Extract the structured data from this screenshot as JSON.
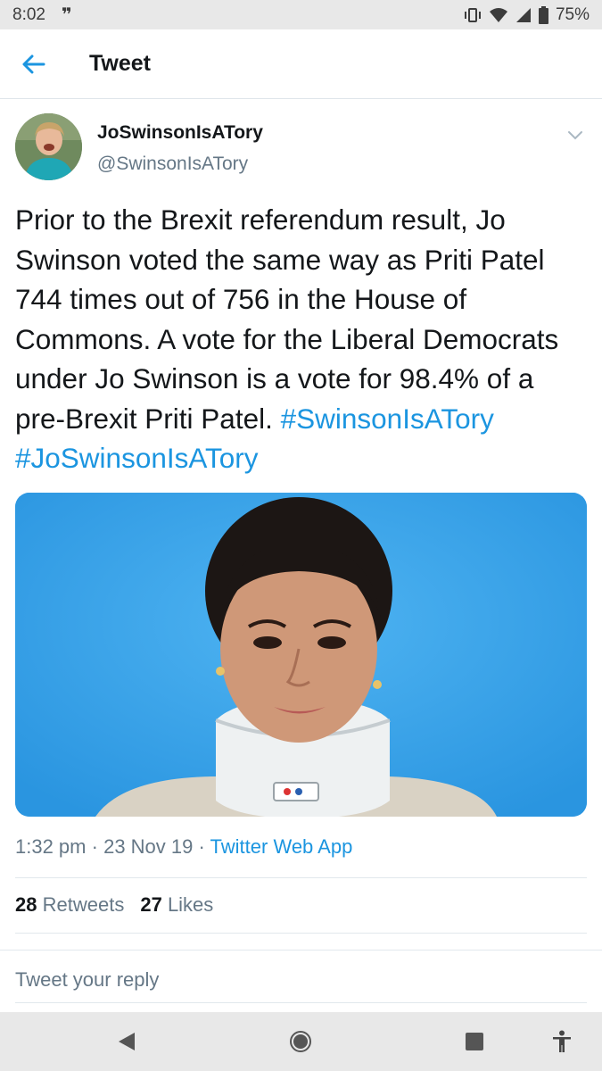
{
  "status_bar": {
    "time": "8:02",
    "notification_glyph": "❞",
    "battery": "75%",
    "icons": [
      "vibrate-icon",
      "wifi-icon",
      "signal-icon",
      "battery-icon"
    ]
  },
  "header": {
    "title": "Tweet",
    "back_icon": "arrow-left-icon"
  },
  "tweet": {
    "display_name": "JoSwinsonIsATory",
    "handle": "@SwinsonIsATory",
    "text": "Prior to the Brexit referendum result, Jo Swinson voted the same way as Priti Patel 744 times out of 756 in the House of Commons. A vote for the Liberal Democrats under Jo Swinson is a vote for 98.4% of a pre-Brexit Priti Patel.",
    "hashtags": [
      "#SwinsonIsATory",
      "#JoSwinsonIsATory"
    ],
    "time": "1:32 pm",
    "date": "23 Nov 19",
    "source": "Twitter Web App",
    "retweets": "28",
    "retweets_label": "Retweets",
    "likes": "27",
    "likes_label": "Likes"
  },
  "reply": {
    "placeholder": "Tweet your reply"
  },
  "nav": {
    "icons": [
      "back-triangle-icon",
      "home-circle-icon",
      "recents-square-icon",
      "accessibility-icon"
    ]
  },
  "colors": {
    "accent": "#1b95e0",
    "secondary_text": "#657786",
    "primary_text": "#14171a",
    "media_bg": "#3aa3e8"
  }
}
